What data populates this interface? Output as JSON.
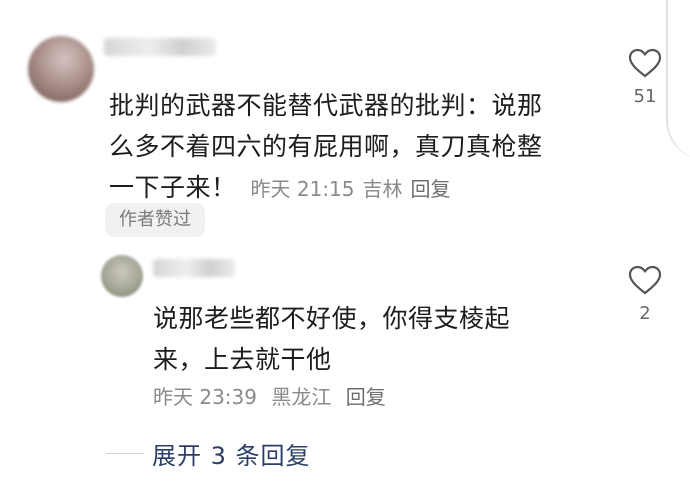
{
  "comment": {
    "text_lines": [
      "批判的武器不能替代武器的批判：说那",
      "么多不着四六的有屁用啊，真刀真枪整",
      "一下子来！"
    ],
    "time": "昨天 21:15",
    "location": "吉林",
    "reply_label": "回复",
    "author_badge": "作者赞过",
    "like_count": "51"
  },
  "reply": {
    "text_lines": [
      "说那老些都不好使，你得支棱起",
      "来，上去就干他"
    ],
    "time": "昨天 23:39",
    "location": "黑龙江",
    "reply_label": "回复",
    "like_count": "2"
  },
  "expand": {
    "label": "展开 3 条回复"
  },
  "icons": {
    "like": "heart-outline-icon"
  },
  "colors": {
    "expand_link": "#2b3f66",
    "meta_text": "#8a8a8a"
  }
}
